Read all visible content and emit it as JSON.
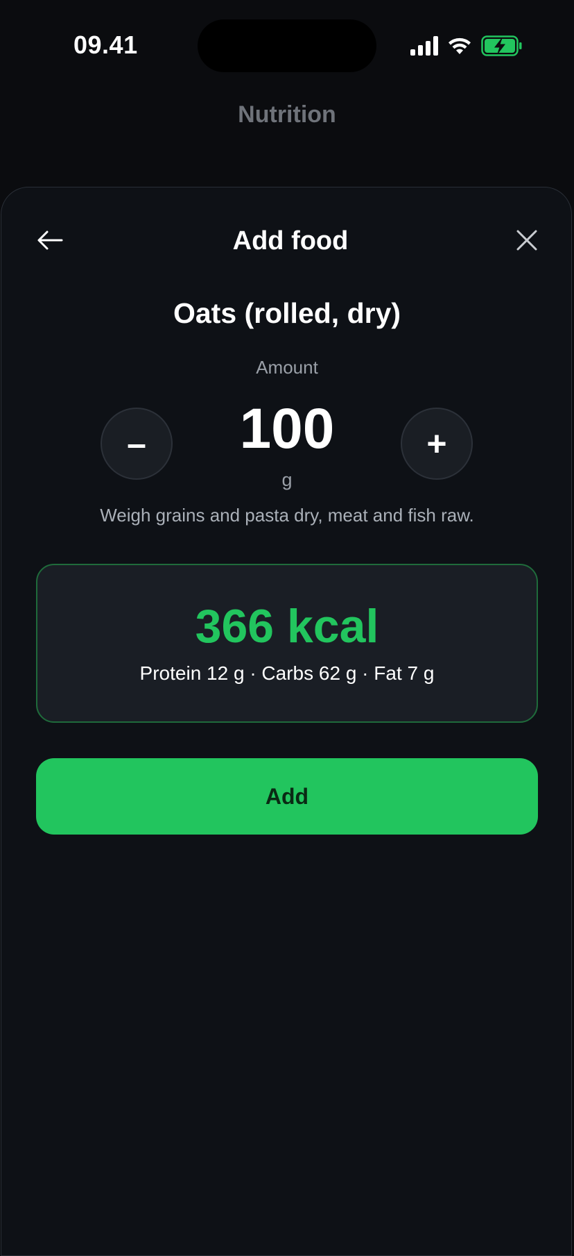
{
  "status_bar": {
    "time": "09.41",
    "icons": [
      "signal-icon",
      "wifi-icon",
      "battery-charging-icon"
    ],
    "battery_color": "#22c55e"
  },
  "background": {
    "title": "Nutrition"
  },
  "sheet": {
    "title": "Add food",
    "back_icon": "arrow-left-icon",
    "close_icon": "close-icon"
  },
  "food": {
    "name": "Oats (rolled, dry)",
    "amount_label": "Amount",
    "amount_value": "100",
    "unit": "g",
    "decrease_label": "–",
    "increase_label": "+",
    "hint": "Weigh grains and pasta dry, meat and fish raw."
  },
  "summary": {
    "kcal": "366 kcal",
    "macros": "Protein 12 g · Carbs 62 g · Fat 7 g"
  },
  "actions": {
    "add_label": "Add"
  },
  "colors": {
    "accent": "#22c55e",
    "background": "#0b0c0f",
    "sheet": "#0e1116",
    "card": "#1a1e25",
    "card_border": "#1f6b3b"
  }
}
